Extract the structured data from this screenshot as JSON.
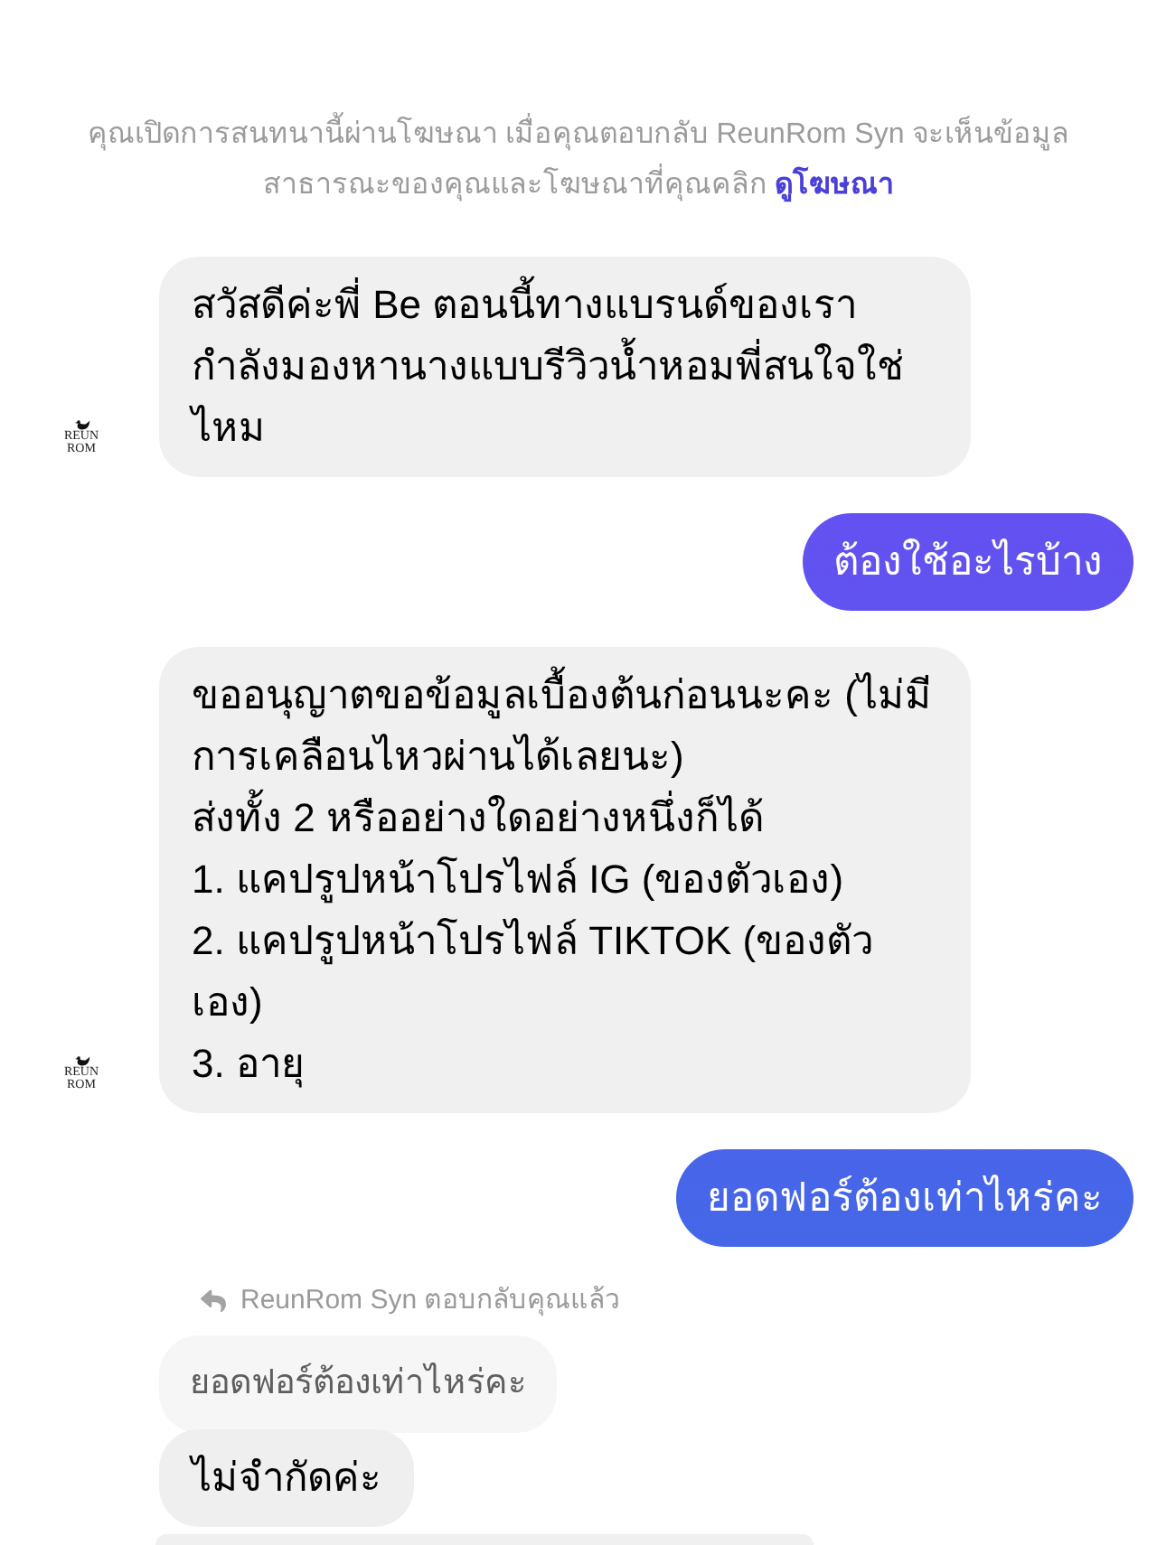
{
  "notice": {
    "text": "คุณเปิดการสนทนานี้ผ่านโฆษณา เมื่อคุณตอบกลับ ReunRom Syn จะเห็นข้อมูลสาธารณะของคุณและโฆษณาที่คุณคลิก",
    "link": "ดูโฆษณา"
  },
  "messages": [
    {
      "kind": "incoming",
      "text": "สวัสดีค่ะพี่ Be ตอนนี้ทางแบรนด์ของเรากำลังมองหานางแบบรีวิวน้ำหอมพี่สนใจใช่ไหม",
      "avatar": {
        "logo_lines": [
          "REUN",
          "ROM"
        ]
      }
    },
    {
      "kind": "outgoing",
      "text": "ต้องใช้อะไรบ้าง"
    },
    {
      "kind": "incoming",
      "text": "ขออนุญาตขอข้อมูลเบื้องต้นก่อนนะคะ (ไม่มีการเคลือนไหวผ่านได้เลยนะ)\nส่งทั้ง 2 หรืออย่างใดอย่างหนึ่งก็ได้\n1. แคปรูปหน้าโปรไฟล์ IG (ของตัวเอง)\n2. แคปรูปหน้าโปรไฟล์ TIKTOK (ของตัวเอง)\n3. อายุ",
      "avatar": {
        "logo_lines": [
          "REUN",
          "ROM"
        ]
      }
    },
    {
      "kind": "outgoing",
      "text": "ยอดฟอร์ต้องเท่าไหร่คะ"
    },
    {
      "kind": "reply",
      "reply_label": "ReunRom Syn ตอบกลับคุณแล้ว",
      "quoted": "ยอดฟอร์ต้องเท่าไหร่คะ",
      "text": "ไม่จำกัดค่ะ"
    },
    {
      "kind": "cut_off"
    }
  ]
}
